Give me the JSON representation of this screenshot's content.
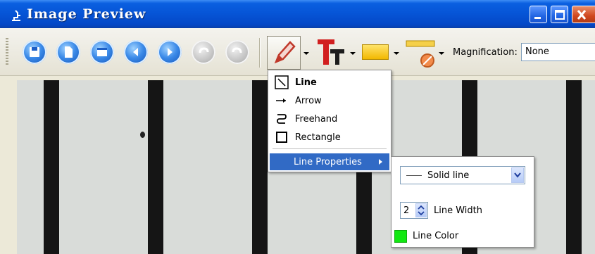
{
  "window": {
    "title": "Image Preview",
    "title_icon": "microscope-icon"
  },
  "toolbar": {
    "buttons": [
      {
        "name": "save",
        "icon": "save-icon",
        "enabled": true
      },
      {
        "name": "new",
        "icon": "new-document-icon",
        "enabled": true
      },
      {
        "name": "window",
        "icon": "window-icon",
        "enabled": true
      },
      {
        "name": "back",
        "icon": "back-arrow-icon",
        "enabled": true
      },
      {
        "name": "forward",
        "icon": "forward-arrow-icon",
        "enabled": true
      },
      {
        "name": "undo",
        "icon": "undo-icon",
        "enabled": false
      },
      {
        "name": "redo",
        "icon": "redo-icon",
        "enabled": false
      }
    ],
    "magnification_label": "Magnification:",
    "magnification_value": "None"
  },
  "draw_menu": {
    "items": [
      {
        "label": "Line",
        "icon": "line-icon",
        "selected": true
      },
      {
        "label": "Arrow",
        "icon": "arrow-icon",
        "selected": false
      },
      {
        "label": "Freehand",
        "icon": "freehand-icon",
        "selected": false
      },
      {
        "label": "Rectangle",
        "icon": "rectangle-icon",
        "selected": false
      }
    ],
    "properties_label": "Line Properties"
  },
  "line_properties": {
    "style_value": "Solid line",
    "width_value": "2",
    "width_label": "Line Width",
    "color_label": "Line Color",
    "color": "#12e812"
  },
  "colors": {
    "titlebar": "#0654d6",
    "highlight": "#316ac5",
    "line_color": "#12e812"
  }
}
